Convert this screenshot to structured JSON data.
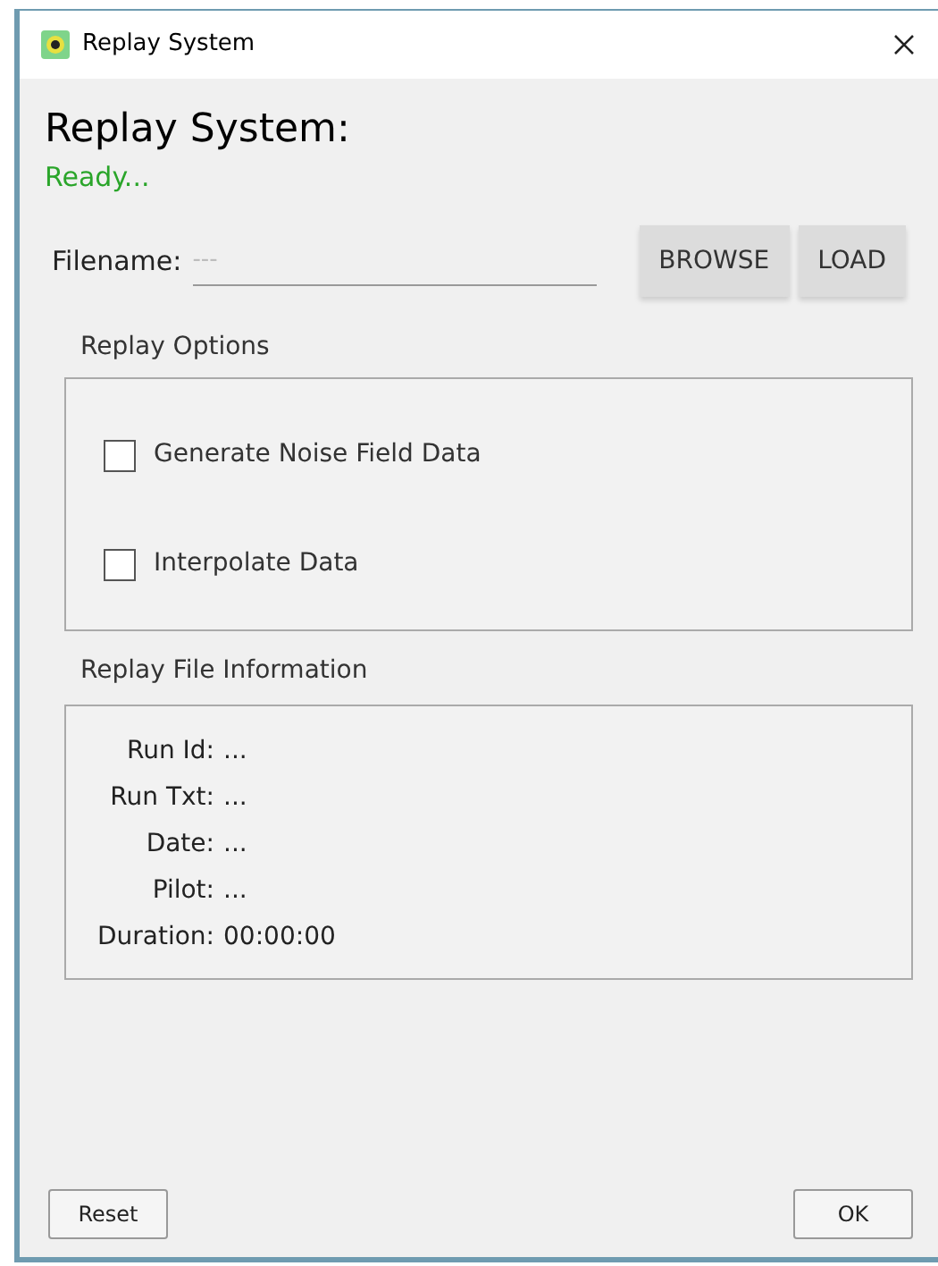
{
  "window": {
    "title": "Replay System"
  },
  "heading": "Replay System:",
  "status": "Ready...",
  "filename": {
    "label": "Filename:",
    "placeholder": "---"
  },
  "buttons": [
    "BROWSE",
    "LOAD"
  ],
  "replay_options": {
    "title": "Replay Options",
    "options": [
      {
        "label": "Generate Noise Field Data",
        "checked": false
      },
      {
        "label": "Interpolate Data",
        "checked": false
      }
    ]
  },
  "file_info": {
    "title": "Replay File Information",
    "rows": [
      {
        "label": "Run Id:",
        "value": "..."
      },
      {
        "label": "Run Txt:",
        "value": "..."
      },
      {
        "label": "Date:",
        "value": "..."
      },
      {
        "label": "Pilot:",
        "value": "..."
      },
      {
        "label": "Duration:",
        "value": "00:00:00"
      }
    ]
  },
  "footer_buttons": [
    "Reset",
    "OK"
  ]
}
